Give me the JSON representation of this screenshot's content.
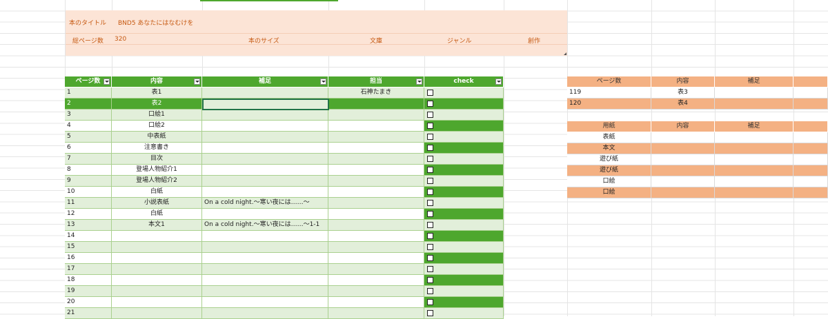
{
  "info": {
    "title_label": "本のタイトル",
    "title_value": "BND5 あなたにはなむけを",
    "pages_label": "総ページ数",
    "pages_value": "320",
    "size_label": "本のサイズ",
    "bunko_label": "文庫",
    "genre_label": "ジャンル",
    "sousaku_label": "創作"
  },
  "main_table": {
    "headers": [
      "ページ数",
      "内容",
      "補足",
      "担当",
      "check"
    ],
    "rows": [
      {
        "page": "1",
        "content": "表1",
        "note": "",
        "owner": "石神たまき"
      },
      {
        "page": "2",
        "content": "表2",
        "note": "",
        "owner": ""
      },
      {
        "page": "3",
        "content": "口絵1",
        "note": "",
        "owner": ""
      },
      {
        "page": "4",
        "content": "口絵2",
        "note": "",
        "owner": ""
      },
      {
        "page": "5",
        "content": "中表紙",
        "note": "",
        "owner": ""
      },
      {
        "page": "6",
        "content": "注意書き",
        "note": "",
        "owner": ""
      },
      {
        "page": "7",
        "content": "目次",
        "note": "",
        "owner": ""
      },
      {
        "page": "8",
        "content": "登場人物紹介1",
        "note": "",
        "owner": ""
      },
      {
        "page": "9",
        "content": "登場人物紹介2",
        "note": "",
        "owner": ""
      },
      {
        "page": "10",
        "content": "白紙",
        "note": "",
        "owner": ""
      },
      {
        "page": "11",
        "content": "小説表紙",
        "note": "On a cold night.～寒い夜には……～",
        "owner": ""
      },
      {
        "page": "12",
        "content": "白紙",
        "note": "",
        "owner": ""
      },
      {
        "page": "13",
        "content": "本文1",
        "note": "On a cold night.～寒い夜には……～1-1",
        "owner": ""
      },
      {
        "page": "14",
        "content": "",
        "note": "",
        "owner": ""
      },
      {
        "page": "15",
        "content": "",
        "note": "",
        "owner": ""
      },
      {
        "page": "16",
        "content": "",
        "note": "",
        "owner": ""
      },
      {
        "page": "17",
        "content": "",
        "note": "",
        "owner": ""
      },
      {
        "page": "18",
        "content": "",
        "note": "",
        "owner": ""
      },
      {
        "page": "19",
        "content": "",
        "note": "",
        "owner": ""
      },
      {
        "page": "20",
        "content": "",
        "note": "",
        "owner": ""
      },
      {
        "page": "21",
        "content": "",
        "note": "",
        "owner": ""
      }
    ]
  },
  "right_table1": {
    "headers": [
      "ページ数",
      "内容",
      "補足"
    ],
    "rows": [
      {
        "page": "119",
        "content": "表3",
        "note": ""
      },
      {
        "page": "120",
        "content": "表4",
        "note": ""
      }
    ]
  },
  "right_table2": {
    "headers": [
      "用紙",
      "内容",
      "補足"
    ],
    "rows": [
      {
        "paper": "表紙",
        "content": "",
        "note": ""
      },
      {
        "paper": "本文",
        "content": "",
        "note": ""
      },
      {
        "paper": "遊び紙",
        "content": "",
        "note": ""
      },
      {
        "paper": "遊び紙",
        "content": "",
        "note": ""
      },
      {
        "paper": "口絵",
        "content": "",
        "note": ""
      },
      {
        "paper": "口絵",
        "content": "",
        "note": ""
      }
    ]
  },
  "colors": {
    "green_dark": "#4ea72e",
    "green_light": "#e2efda",
    "orange": "#f4b183",
    "peach": "#fce4d6",
    "orange_text": "#c65911"
  }
}
